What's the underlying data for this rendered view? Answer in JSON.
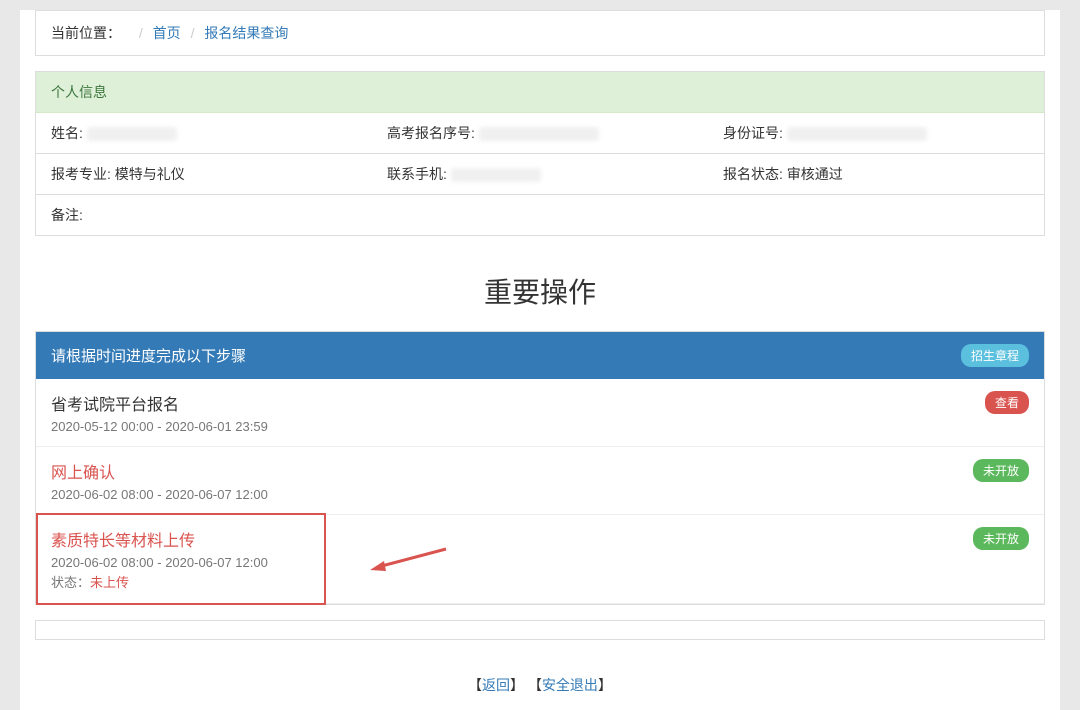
{
  "breadcrumb": {
    "label": "当前位置：",
    "home": "首页",
    "current": "报名结果查询"
  },
  "personal": {
    "header": "个人信息",
    "fields": {
      "name_label": "姓名:",
      "exam_no_label": "高考报名序号:",
      "id_label": "身份证号:",
      "major_label": "报考专业:",
      "major_value": "模特与礼仪",
      "phone_label": "联系手机:",
      "status_label": "报名状态:",
      "status_value": "审核通过",
      "remark_label": "备注:"
    }
  },
  "important_ops": {
    "title": "重要操作",
    "header": "请根据时间进度完成以下步骤",
    "admission_btn": "招生章程",
    "steps": [
      {
        "name": "省考试院平台报名",
        "time": "2020-05-12 00:00 - 2020-06-01 23:59",
        "action": "查看",
        "action_color": "red",
        "name_red": false,
        "highlighted": false
      },
      {
        "name": "网上确认",
        "time": "2020-06-02 08:00 - 2020-06-07 12:00",
        "action": "未开放",
        "action_color": "green",
        "name_red": true,
        "highlighted": false
      },
      {
        "name": "素质特长等材料上传",
        "time": "2020-06-02 08:00 - 2020-06-07 12:00",
        "action": "未开放",
        "action_color": "green",
        "name_red": true,
        "highlighted": true,
        "status_label": "状态：",
        "status_value": "未上传"
      }
    ]
  },
  "footer": {
    "back": "返回",
    "logout": "安全退出"
  }
}
